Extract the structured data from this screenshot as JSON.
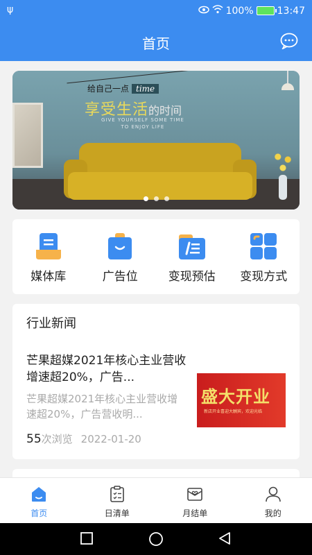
{
  "status_bar": {
    "battery": "100%",
    "time": "13:47"
  },
  "header": {
    "title": "首页"
  },
  "banner": {
    "line1": "给自己一点",
    "time_word": "time",
    "line2_main": "享受生活",
    "line2_tail": "的时间",
    "line3a": "GIVE YOURSELF SOME TIME",
    "line3b": "TO ENJOY LIFE"
  },
  "quick_menu": [
    {
      "label": "媒体库",
      "icon": "media-library-icon"
    },
    {
      "label": "广告位",
      "icon": "ad-slot-icon"
    },
    {
      "label": "变现预估",
      "icon": "estimate-icon"
    },
    {
      "label": "变现方式",
      "icon": "methods-icon"
    }
  ],
  "news": {
    "heading": "行业新闻",
    "title": "芒果超媒2021年核心主业营收增速超20%，广告...",
    "summary": "芒果超媒2021年核心主业营收增速超20%，广告营收明...",
    "views": "55",
    "views_suffix": "次浏览",
    "date": "2022-01-20",
    "thumb_text": "盛大开业",
    "thumb_subtext": "新店开业喜迎大酬宾，欢迎光临"
  },
  "tabbar": [
    {
      "label": "首页",
      "icon": "home-icon",
      "active": true
    },
    {
      "label": "日清单",
      "icon": "daily-list-icon",
      "active": false
    },
    {
      "label": "月结单",
      "icon": "monthly-statement-icon",
      "active": false
    },
    {
      "label": "我的",
      "icon": "profile-icon",
      "active": false
    }
  ],
  "colors": {
    "primary": "#3c8cf0",
    "muted_text": "#a9a9a9"
  }
}
